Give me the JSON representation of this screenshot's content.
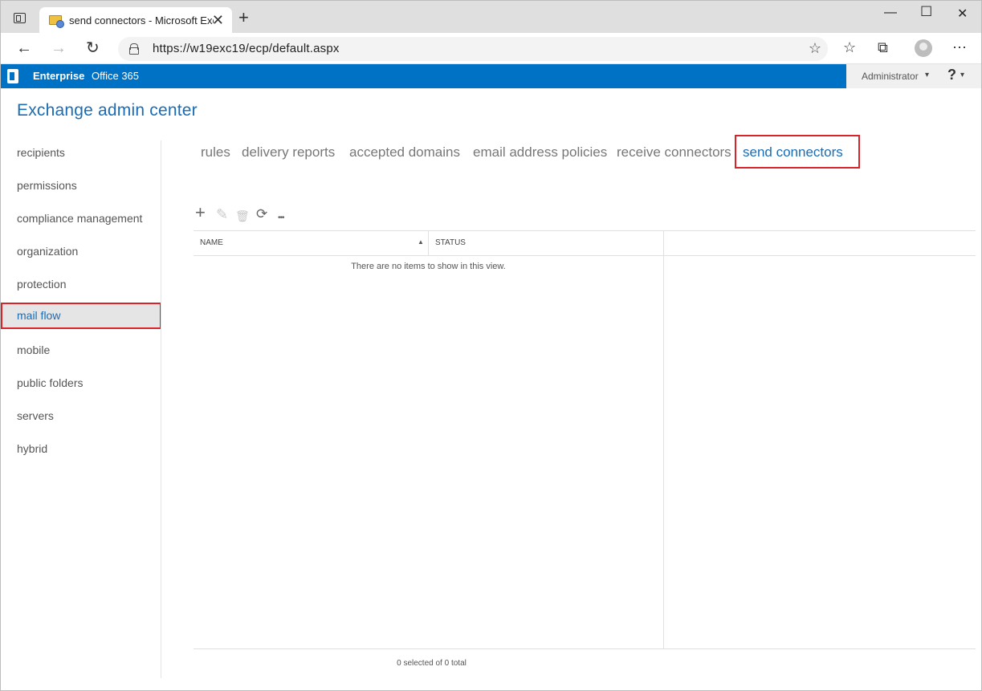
{
  "browser": {
    "tab_title": "send connectors - Microsoft Exchange",
    "tab_close": "✕",
    "new_tab": "+",
    "url": "https://w19exc19/ecp/default.aspx",
    "window_controls": {
      "minimize": "—",
      "maximize": "☐",
      "close": "✕"
    },
    "nav": {
      "back": "←",
      "forward": "→",
      "refresh": "↻"
    },
    "toolbar_icons": {
      "favorite": "☆",
      "favorites": "☆",
      "collections": "⧉",
      "more": "⋯"
    }
  },
  "appbar": {
    "links": [
      "Enterprise",
      "Office 365"
    ],
    "user": "Administrator",
    "help": "?",
    "caret": "▾"
  },
  "eac_title": "Exchange admin center",
  "left_nav": {
    "items": [
      "recipients",
      "permissions",
      "compliance management",
      "organization",
      "protection",
      "mail flow",
      "mobile",
      "public folders",
      "servers",
      "hybrid"
    ],
    "selected": "mail flow"
  },
  "sub_tabs": {
    "items": [
      "rules",
      "delivery reports",
      "accepted domains",
      "email address policies",
      "receive connectors",
      "send connectors"
    ],
    "selected": "send connectors"
  },
  "toolbar": {
    "add": "+",
    "edit": "✎",
    "delete": "🗑",
    "refresh": "⟳",
    "more": "•••"
  },
  "grid": {
    "columns": [
      "NAME",
      "STATUS"
    ],
    "sort_indicator": "▲",
    "empty_message": "There are no items to show in this view.",
    "status": "0 selected of 0 total"
  },
  "colors": {
    "accent": "#1a6cb5",
    "appbar": "#0072c6",
    "highlight": "#d8232a"
  }
}
